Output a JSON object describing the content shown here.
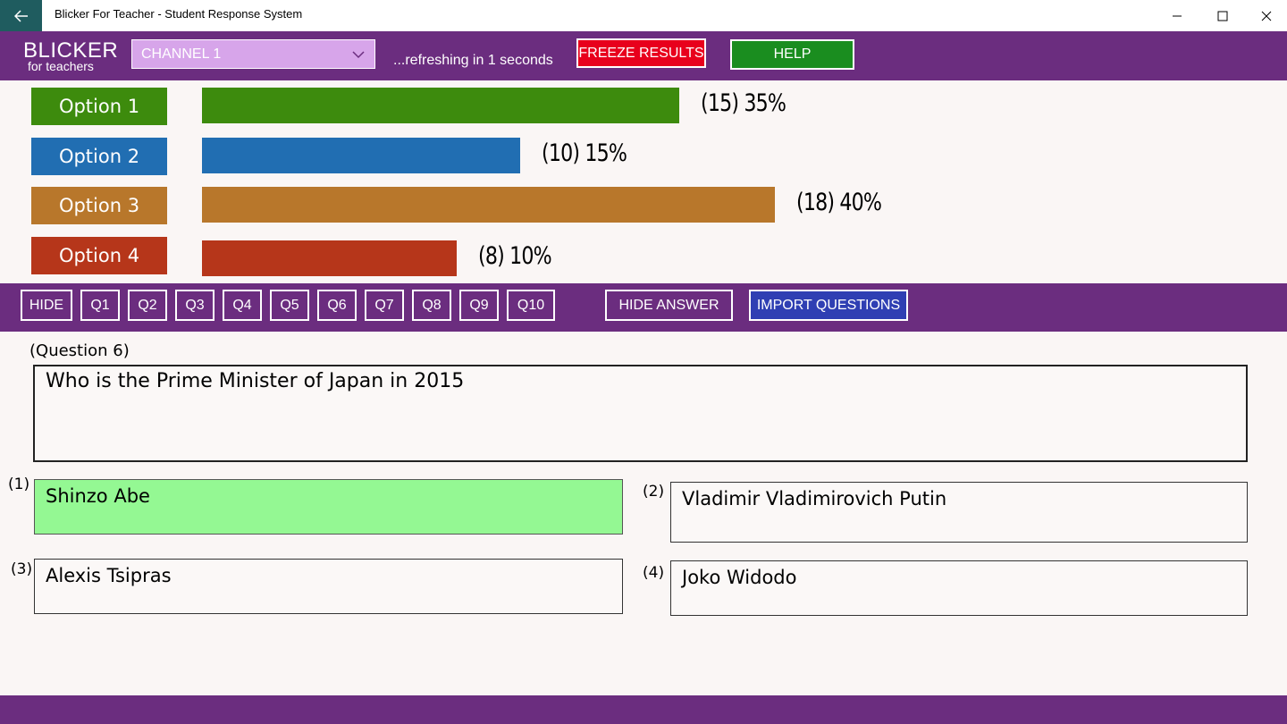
{
  "window": {
    "title": "Blicker For Teacher - Student Response System"
  },
  "header": {
    "logo_main": "BLICKER",
    "logo_sub": "for teachers",
    "channel": "CHANNEL 1",
    "refresh_text": "...refreshing in 1 seconds",
    "freeze_label": "FREEZE RESULTS",
    "help_label": "HELP"
  },
  "results": [
    {
      "label": "Option 1",
      "count": 15,
      "percent": 35,
      "stat": "(15) 35%",
      "color": "#3d8b0d"
    },
    {
      "label": "Option 2",
      "count": 10,
      "percent": 15,
      "stat": "(10) 15%",
      "color": "#216eb2"
    },
    {
      "label": "Option 3",
      "count": 18,
      "percent": 40,
      "stat": "(18) 40%",
      "color": "#b8772b"
    },
    {
      "label": "Option 4",
      "count": 8,
      "percent": 10,
      "stat": "(8) 10%",
      "color": "#b6361a"
    }
  ],
  "question_nav": {
    "hide_label": "HIDE",
    "questions": [
      "Q1",
      "Q2",
      "Q3",
      "Q4",
      "Q5",
      "Q6",
      "Q7",
      "Q8",
      "Q9",
      "Q10"
    ],
    "hide_answer_label": "HIDE ANSWER",
    "import_label": "IMPORT QUESTIONS"
  },
  "question": {
    "number_label": "(Question 6)",
    "text": "Who is the Prime Minister of Japan in 2015",
    "answers": [
      {
        "index": "(1)",
        "text": "Shinzo Abe",
        "correct": true
      },
      {
        "index": "(2)",
        "text": "Vladimir Vladimirovich Putin",
        "correct": false
      },
      {
        "index": "(3)",
        "text": "Alexis Tsipras",
        "correct": false
      },
      {
        "index": "(4)",
        "text": "Joko Widodo",
        "correct": false
      }
    ]
  },
  "colors": {
    "purple": "#6b2d7f",
    "correct_green": "#94f893",
    "freeze_red": "#e8001c",
    "help_green": "#1a8d1f",
    "import_blue": "#2f3fb3"
  }
}
